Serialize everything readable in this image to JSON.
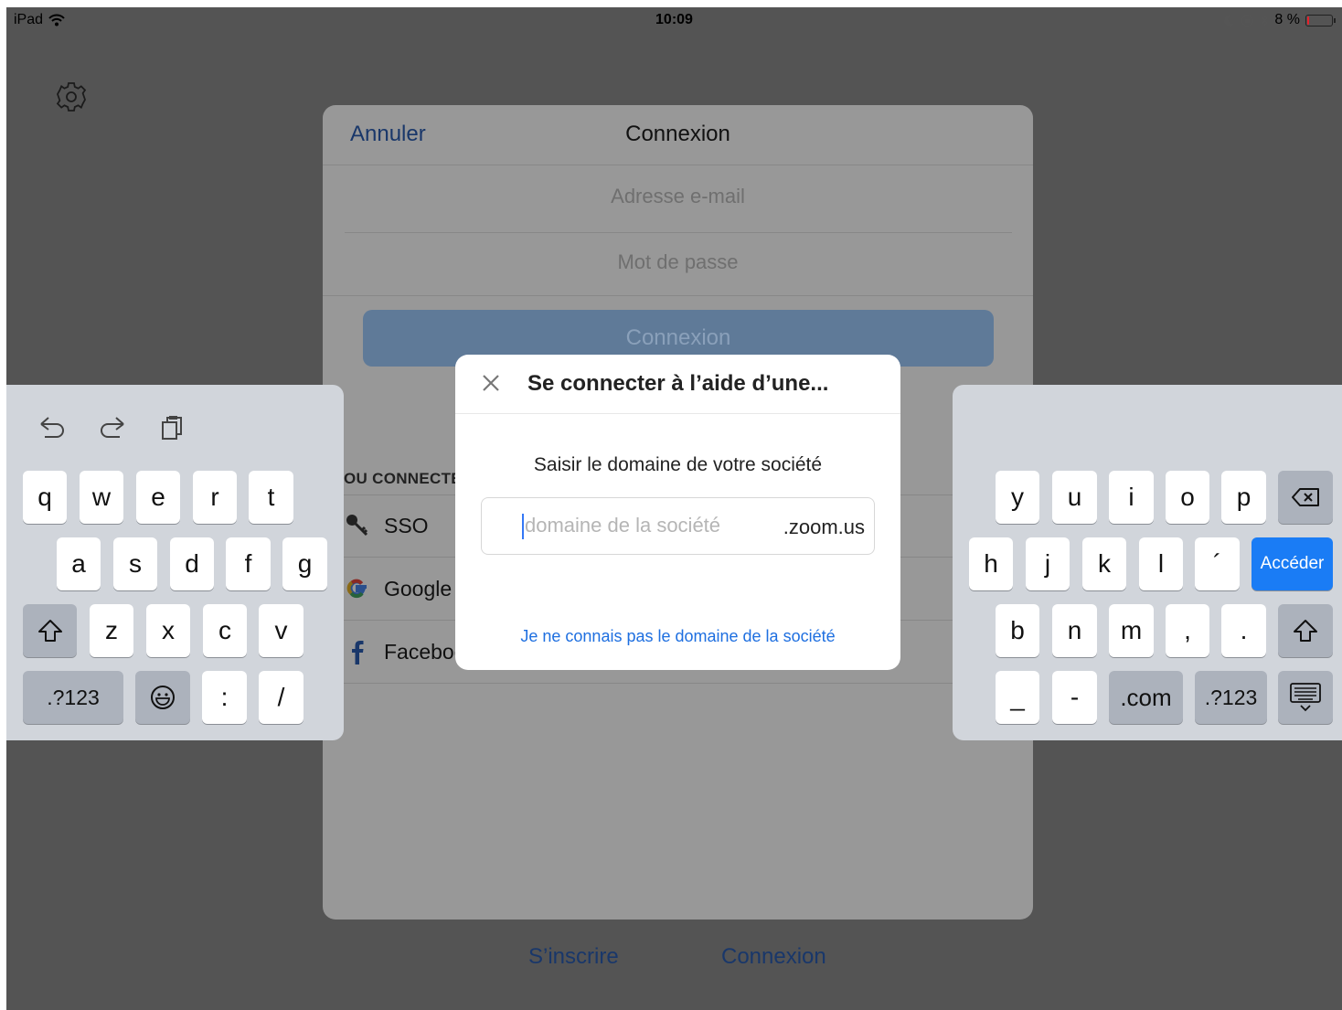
{
  "status_bar": {
    "device": "iPad",
    "time": "10:09",
    "battery": "8 %",
    "battery_level": 0.08
  },
  "login_sheet": {
    "cancel": "Annuler",
    "title": "Connexion",
    "email_placeholder": "Adresse e-mail",
    "password_placeholder": "Mot de passe",
    "signin_button": "Connexion",
    "or_label": "OU CONNECTEZ-VOUS AVEC",
    "options": [
      "SSO",
      "Google",
      "Facebook"
    ]
  },
  "bottom": {
    "signup": "S’inscrire",
    "signin": "Connexion"
  },
  "dialog": {
    "title": "Se connecter à l’aide d’une...",
    "prompt": "Saisir le domaine de votre société",
    "input_placeholder": "domaine de la société",
    "input_value": "",
    "suffix": ".zoom.us",
    "link": "Je ne connais pas le domaine de la société"
  },
  "keyboard": {
    "left": {
      "row1": [
        "q",
        "w",
        "e",
        "r",
        "t"
      ],
      "row2": [
        "a",
        "s",
        "d",
        "f",
        "g"
      ],
      "row3": [
        "z",
        "x",
        "c",
        "v"
      ],
      "row4": [
        ".?123",
        ":",
        "/"
      ]
    },
    "right": {
      "row1": [
        "y",
        "u",
        "i",
        "o",
        "p"
      ],
      "row2": [
        "h",
        "j",
        "k",
        "l",
        "´"
      ],
      "go": "Accéder",
      "row3": [
        "b",
        "n",
        "m",
        ",",
        "."
      ],
      "row4": [
        "_",
        "-",
        ".com",
        ".?123"
      ]
    }
  },
  "icons": {
    "settings": "gear-icon",
    "close": "close-icon",
    "sso": "key-icon",
    "google": "google-icon",
    "facebook": "facebook-icon",
    "undo": "undo-icon",
    "redo": "redo-icon",
    "paste": "paste-icon",
    "shift": "shift-icon",
    "delete": "backspace-icon",
    "emoji": "emoji-icon",
    "hide_keyboard": "hide-keyboard-icon"
  },
  "colors": {
    "accent_blue": "#1a7cf5",
    "link_blue": "#1e6fe0",
    "dim_link": "#19376a",
    "battery_low": "#e6202a"
  }
}
